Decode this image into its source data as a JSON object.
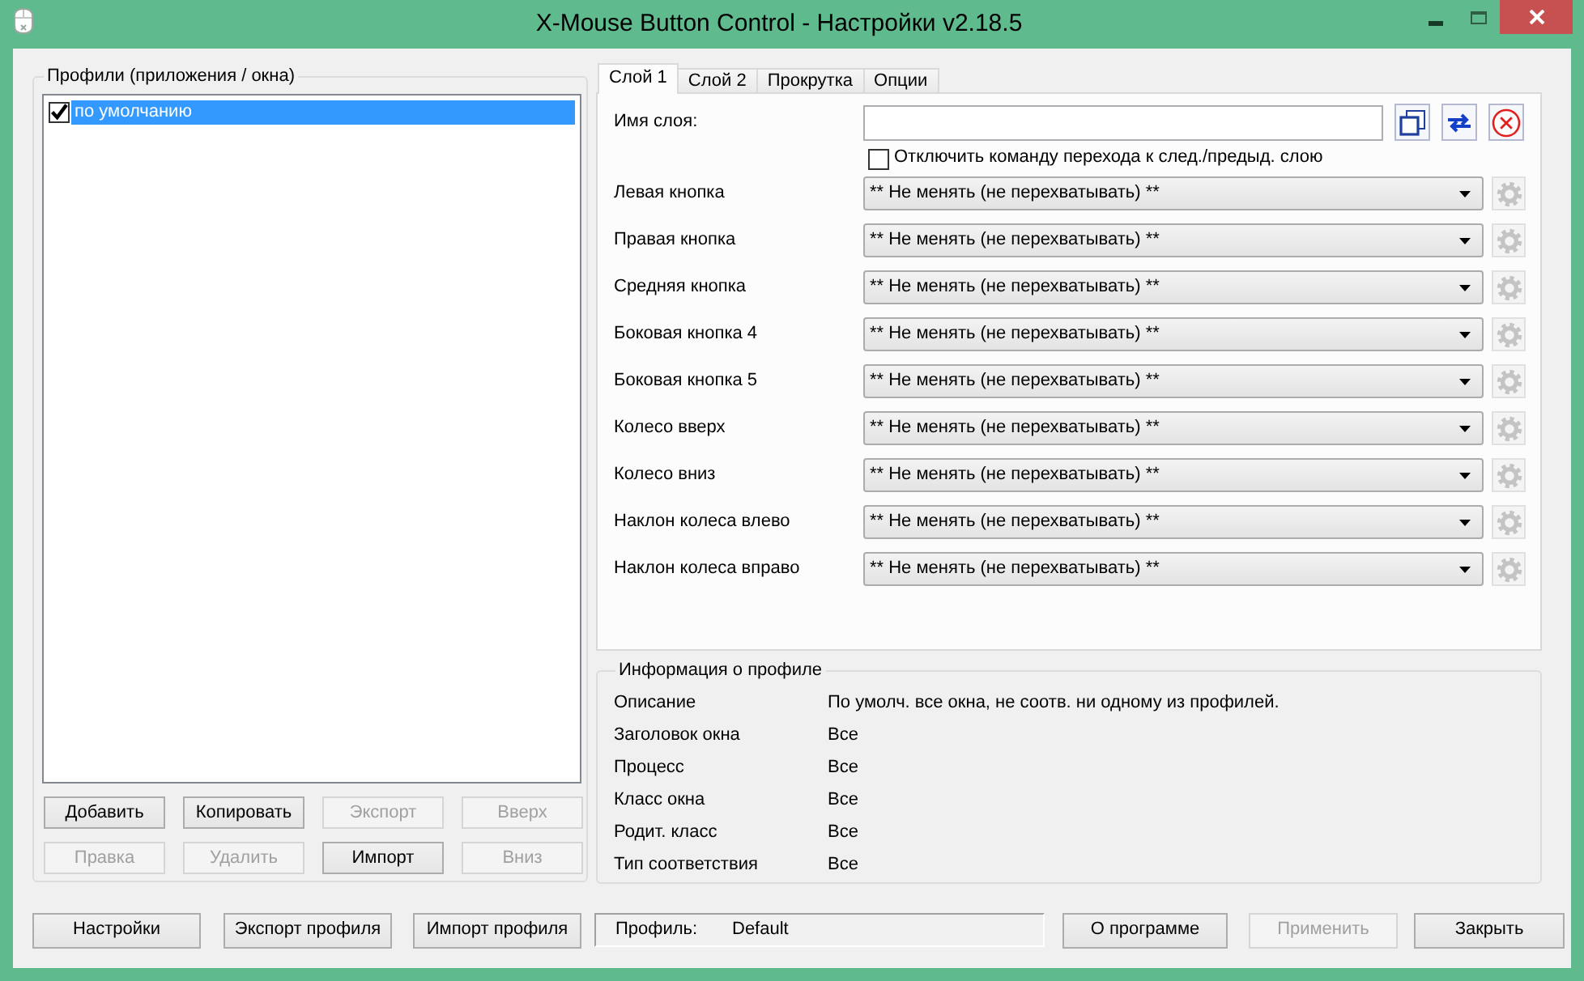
{
  "window": {
    "title": "X-Mouse Button Control - Настройки v2.18.5"
  },
  "profiles": {
    "title": "Профили (приложения / окна)",
    "items": [
      {
        "label": "по умолчанию",
        "checked": true,
        "selected": true
      }
    ],
    "buttons": [
      {
        "label": "Добавить",
        "disabled": false
      },
      {
        "label": "Копировать",
        "disabled": false
      },
      {
        "label": "Экспорт",
        "disabled": true
      },
      {
        "label": "Вверх",
        "disabled": true
      },
      {
        "label": "Правка",
        "disabled": true
      },
      {
        "label": "Удалить",
        "disabled": true
      },
      {
        "label": "Импорт",
        "disabled": false
      },
      {
        "label": "Вниз",
        "disabled": true
      }
    ]
  },
  "tabs": [
    {
      "label": "Слой 1",
      "selected": true
    },
    {
      "label": "Слой 2",
      "selected": false
    },
    {
      "label": "Прокрутка",
      "selected": false
    },
    {
      "label": "Опции",
      "selected": false
    }
  ],
  "layer": {
    "name_label": "Имя слоя:",
    "disable_switch": {
      "label": "Отключить команду перехода к след./предыд. слою",
      "checked": false
    },
    "actions": [
      {
        "label": "Левая кнопка",
        "value": "** Не менять (не перехватывать) **",
        "settings_disabled": true
      },
      {
        "label": "Правая кнопка",
        "value": "** Не менять (не перехватывать) **",
        "settings_disabled": true
      },
      {
        "label": "Средняя кнопка",
        "value": "** Не менять (не перехватывать) **",
        "settings_disabled": true
      },
      {
        "label": "Боковая кнопка 4",
        "value": "** Не менять (не перехватывать) **",
        "settings_disabled": true
      },
      {
        "label": "Боковая кнопка 5",
        "value": "** Не менять (не перехватывать) **",
        "settings_disabled": true
      },
      {
        "label": "Колесо вверх",
        "value": "** Не менять (не перехватывать) **",
        "settings_disabled": true
      },
      {
        "label": "Колесо вниз",
        "value": "** Не менять (не перехватывать) **",
        "settings_disabled": true
      },
      {
        "label": "Наклон колеса влево",
        "value": "** Не менять (не перехватывать) **",
        "settings_disabled": true
      },
      {
        "label": "Наклон колеса вправо",
        "value": "** Не менять (не перехватывать) **",
        "settings_disabled": true
      }
    ]
  },
  "profile_info": {
    "title": "Информация о профиле",
    "rows": [
      {
        "label": "Описание",
        "value": "По умолч. все окна, не соотв. ни одному из профилей."
      },
      {
        "label": "Заголовок окна",
        "value": "Все"
      },
      {
        "label": "Процесс",
        "value": "Все"
      },
      {
        "label": "Класс окна",
        "value": "Все"
      },
      {
        "label": "Родит. класс",
        "value": "Все"
      },
      {
        "label": "Тип соответствия",
        "value": "Все"
      }
    ]
  },
  "footer": {
    "left_buttons": [
      {
        "label": "Настройки",
        "disabled": false
      },
      {
        "label": "Экспорт профиля",
        "disabled": false
      },
      {
        "label": "Импорт профиля",
        "disabled": false
      }
    ],
    "status": {
      "label": "Профиль:",
      "value": "Default"
    },
    "right_buttons": [
      {
        "label": "О программе",
        "disabled": false
      },
      {
        "label": "Применить",
        "disabled": true
      },
      {
        "label": "Закрыть",
        "disabled": false
      }
    ]
  }
}
